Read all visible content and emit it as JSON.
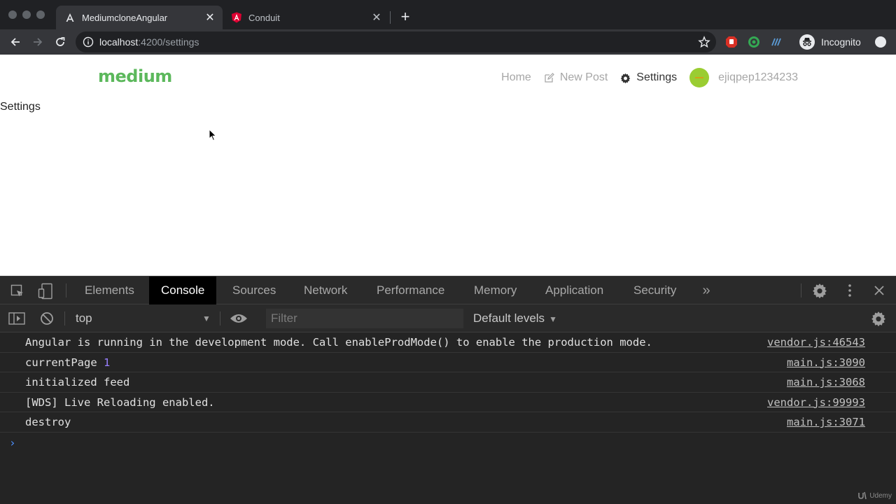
{
  "browser": {
    "tabs": [
      {
        "title": "MediumcloneAngular",
        "active": true
      },
      {
        "title": "Conduit",
        "active": false
      }
    ],
    "address": {
      "host": "localhost",
      "path": ":4200/settings"
    },
    "profile_label": "Incognito"
  },
  "app": {
    "brand": "medium",
    "nav": {
      "home": "Home",
      "new_post": "New Post",
      "settings": "Settings",
      "username": "ejiqpep1234233"
    },
    "heading": "Settings"
  },
  "devtools": {
    "tabs": [
      "Elements",
      "Console",
      "Sources",
      "Network",
      "Performance",
      "Memory",
      "Application",
      "Security"
    ],
    "active_tab": "Console",
    "context": "top",
    "filter_placeholder": "Filter",
    "levels": "Default levels",
    "messages": [
      {
        "text": "Angular is running in the development mode. Call enableProdMode() to enable the production mode.",
        "source": "vendor.js:46543"
      },
      {
        "text": "currentPage",
        "value": "1",
        "source": "main.js:3090"
      },
      {
        "text": "initialized feed",
        "source": "main.js:3068"
      },
      {
        "text": "[WDS] Live Reloading enabled.",
        "source": "vendor.js:99993"
      },
      {
        "text": "destroy",
        "source": "main.js:3071"
      }
    ]
  },
  "watermark": "Udemy",
  "colors": {
    "brand_green": "#5cb85c",
    "avatar": "#9acd32",
    "console_number": "#9980ff"
  }
}
